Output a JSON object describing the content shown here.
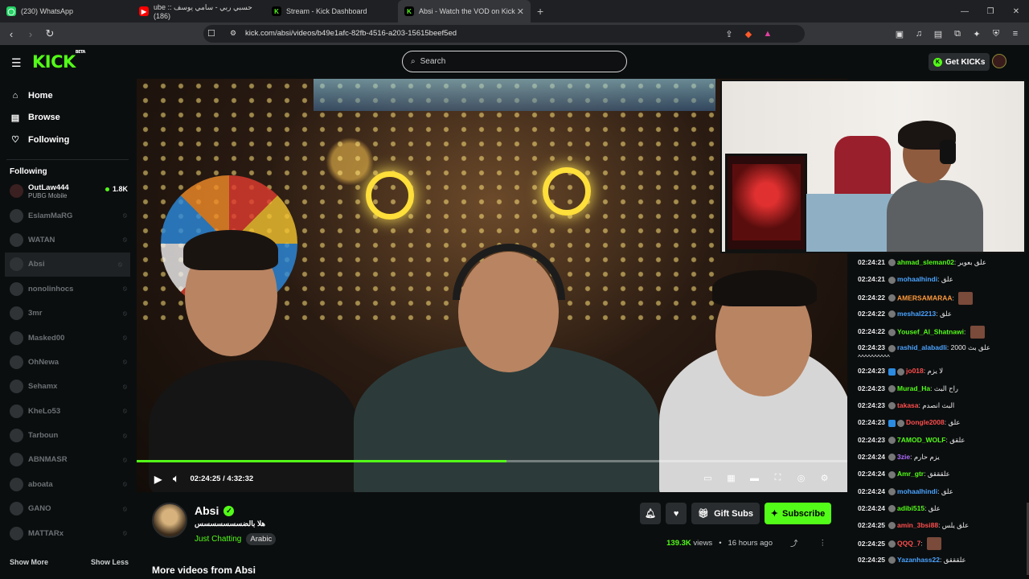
{
  "browser": {
    "tabs": [
      {
        "label": "(230) WhatsApp",
        "icon": "whatsapp-icon",
        "color": "#25d366",
        "active": false
      },
      {
        "label": "ube :: حسبي ربي - سامي يوسف (186)",
        "icon": "youtube-icon",
        "color": "#ff0000",
        "active": false
      },
      {
        "label": "Stream - Kick Dashboard",
        "icon": "kick-icon",
        "color": "#53fc18",
        "active": false
      },
      {
        "label": "Absi - Watch the VOD on Kick",
        "icon": "kick-icon",
        "color": "#53fc18",
        "active": true
      }
    ],
    "url": "kick.com/absi/videos/b49e1afc-82fb-4516-a203-15615beef5ed"
  },
  "header": {
    "logo": "KICK",
    "logo_badge": "BETA",
    "search_placeholder": "Search",
    "get_kicks": "Get KICKs"
  },
  "sidebar": {
    "nav": [
      {
        "label": "Home",
        "icon": "home-icon"
      },
      {
        "label": "Browse",
        "icon": "browse-icon"
      },
      {
        "label": "Following",
        "icon": "heart-icon"
      }
    ],
    "following_title": "Following",
    "live_channel": {
      "name": "OutLaw444",
      "category": "PUBG Mobile",
      "viewers": "1.8K"
    },
    "offline_channels": [
      "EslamMaRG",
      "WATAN",
      "Absi",
      "nonolinhocs",
      "3mr",
      "Masked00",
      "OhNewa",
      "Sehamx",
      "KheLo53",
      "Tarboun",
      "ABNMASR",
      "aboata",
      "GANO",
      "MATTARx"
    ],
    "show_more": "Show More",
    "show_less": "Show Less"
  },
  "player": {
    "current_time": "02:24:25",
    "separator": "/",
    "duration": "4:32:32",
    "progress": 0.52
  },
  "channel": {
    "name": "Absi",
    "title": "هلا بالضسسسسسسس",
    "category": "Just Chatting",
    "tag": "Arabic",
    "views": "139.3K",
    "views_label": "views",
    "posted": "16 hours ago",
    "gift_subs": "Gift Subs",
    "subscribe": "Subscribe",
    "more_videos": "More videos from Absi"
  },
  "chat": [
    {
      "time": "02:24:21",
      "user": "ahmad_sleman02",
      "color": "#53fc18",
      "text": "علق بعوير"
    },
    {
      "time": "02:24:21",
      "user": "mohaalhindi",
      "color": "#4aa3ff",
      "text": "علق"
    },
    {
      "time": "02:24:22",
      "user": "AMERSAMARAA",
      "color": "#ff9a3c",
      "text": "",
      "emote": true
    },
    {
      "time": "02:24:22",
      "user": "meshal2213",
      "color": "#4aa3ff",
      "text": "علق"
    },
    {
      "time": "02:24:22",
      "user": "Yousef_Al_Shatnawi",
      "color": "#53fc18",
      "text": "",
      "emote": true
    },
    {
      "time": "02:24:23",
      "user": "rashid_alabadli",
      "color": "#4aa3ff",
      "text": "علق بث 2000 ^^^^^^^^^^"
    },
    {
      "time": "02:24:23",
      "user": "jo018",
      "color": "#ff4d4d",
      "text": "لا يزم",
      "badges": true
    },
    {
      "time": "02:24:23",
      "user": "Murad_Ha",
      "color": "#53fc18",
      "text": "راح البث"
    },
    {
      "time": "02:24:23",
      "user": "takasa",
      "color": "#ff4d4d",
      "text": "البث انصدم"
    },
    {
      "time": "02:24:23",
      "user": "Dongle2008",
      "color": "#ff4d4d",
      "text": "علق",
      "badges": true
    },
    {
      "time": "02:24:23",
      "user": "7AMOD_WOLF",
      "color": "#53fc18",
      "text": "علقق"
    },
    {
      "time": "02:24:24",
      "user": "3zie",
      "color": "#b06cff",
      "text": "يزم حارم"
    },
    {
      "time": "02:24:24",
      "user": "Amr_gtr",
      "color": "#53fc18",
      "text": "علقققق"
    },
    {
      "time": "02:24:24",
      "user": "mohaalhindi",
      "color": "#4aa3ff",
      "text": "علق"
    },
    {
      "time": "02:24:24",
      "user": "adibi515",
      "color": "#53fc18",
      "text": "علق"
    },
    {
      "time": "02:24:25",
      "user": "amin_3bsi88",
      "color": "#ff4d4d",
      "text": "علق يلس"
    },
    {
      "time": "02:24:25",
      "user": "QQQ_7",
      "color": "#ff4d4d",
      "text": "",
      "emote": true
    },
    {
      "time": "02:24:25",
      "user": "Yazanhass22",
      "color": "#4aa3ff",
      "text": "علقققق"
    }
  ]
}
